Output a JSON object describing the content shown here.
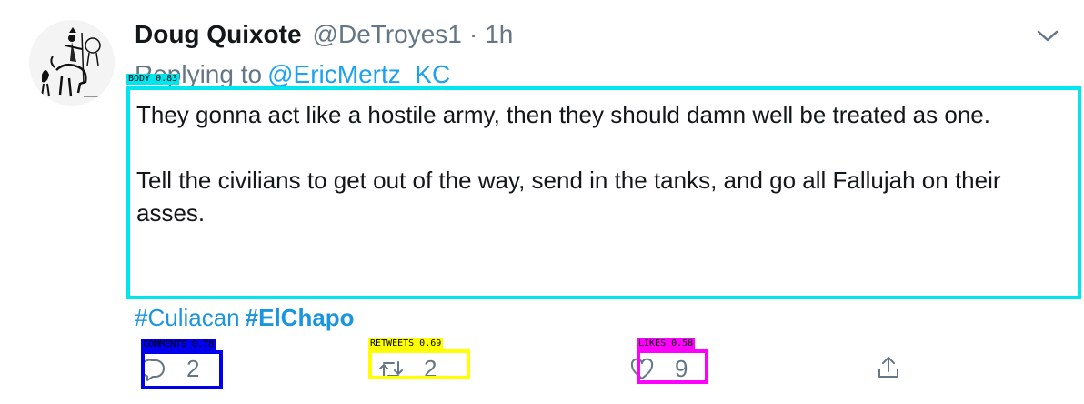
{
  "tweet": {
    "display_name": "Doug Quixote",
    "handle": "@DeTroyes1",
    "separator": "·",
    "time": "1h",
    "replying_prefix": "Replying to",
    "replying_to": "@EricMertz_KC",
    "text_paragraph_1": "They gonna act like a hostile army, then they should damn well be treated as one.",
    "text_paragraph_2": "Tell the civilians to get out of the way, send in the tanks, and go all Fallujah on their asses.",
    "hashtag_1": "#Culiacan",
    "hashtag_2": "#ElChapo"
  },
  "actions": {
    "comments": {
      "icon": "reply-icon",
      "count": "2"
    },
    "retweets": {
      "icon": "retweet-icon",
      "count": "2"
    },
    "likes": {
      "icon": "heart-icon",
      "count": "9"
    },
    "share": {
      "icon": "share-icon"
    }
  },
  "annotations": {
    "body": {
      "label": "BODY 0.83",
      "color": "#00e5ee"
    },
    "comments": {
      "label": "COMMENTS 0.78",
      "color": "#0000ee"
    },
    "retweets": {
      "label": "RETWEETS 0.69",
      "color": "#ffff00"
    },
    "likes": {
      "label": "LIKES 0.58",
      "color": "#ff00ff"
    }
  },
  "colors": {
    "text": "#14171a",
    "muted": "#657786",
    "link": "#1da1f2"
  }
}
